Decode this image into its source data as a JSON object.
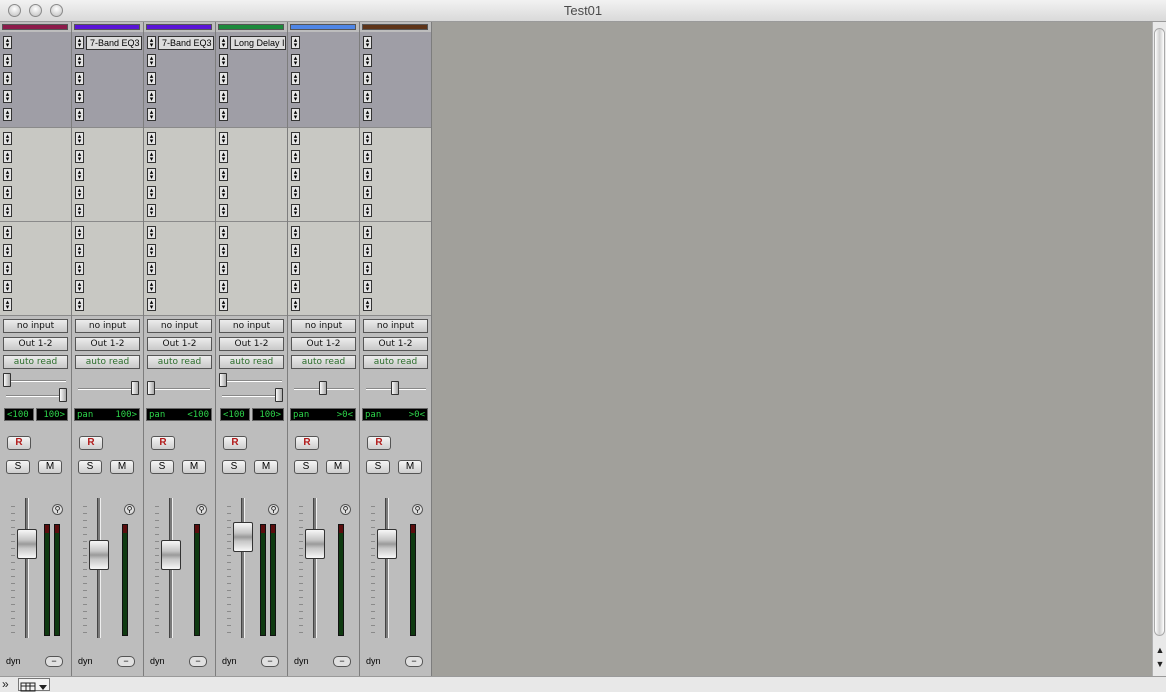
{
  "window": {
    "title": "Test01"
  },
  "tracks": [
    {
      "color": "#8c1b4a",
      "inserts": [
        "",
        "",
        "",
        "",
        ""
      ],
      "input": "no input",
      "output": "Out 1-2",
      "automation": "auto read",
      "stereo": true,
      "pan_left": "<100",
      "pan_right": "100>",
      "pan_label": "",
      "pan_value": "",
      "pan_fraction": 0.0,
      "pan2_fraction": 1.0,
      "record": "R",
      "solo": "S",
      "mute": "M",
      "fader_level": 0.74,
      "dyn": "dyn",
      "dash": "−"
    },
    {
      "color": "#5a14d6",
      "inserts": [
        "7-Band EQ3",
        "",
        "",
        "",
        ""
      ],
      "input": "no input",
      "output": "Out 1-2",
      "automation": "auto read",
      "stereo": false,
      "pan_label": "pan",
      "pan_value": "100>",
      "pan_fraction": 1.0,
      "record": "R",
      "solo": "S",
      "mute": "M",
      "fader_level": 0.64,
      "dyn": "dyn",
      "dash": "−"
    },
    {
      "color": "#5a14d6",
      "inserts": [
        "7-Band EQ3",
        "",
        "",
        "",
        ""
      ],
      "input": "no input",
      "output": "Out 1-2",
      "automation": "auto read",
      "stereo": false,
      "pan_label": "pan",
      "pan_value": "<100",
      "pan_fraction": 0.0,
      "record": "R",
      "solo": "S",
      "mute": "M",
      "fader_level": 0.64,
      "dyn": "dyn",
      "dash": "−"
    },
    {
      "color": "#1d8a3c",
      "inserts": [
        "Long Delay II",
        "",
        "",
        "",
        ""
      ],
      "input": "no input",
      "output": "Out 1-2",
      "automation": "auto read",
      "stereo": true,
      "pan_left": "<100",
      "pan_right": "100>",
      "pan_label": "",
      "pan_value": "",
      "pan_fraction": 0.0,
      "pan2_fraction": 1.0,
      "record": "R",
      "solo": "S",
      "mute": "M",
      "fader_level": 0.8,
      "dyn": "dyn",
      "dash": "−"
    },
    {
      "color": "#4f86e6",
      "inserts": [
        "",
        "",
        "",
        "",
        ""
      ],
      "input": "no input",
      "output": "Out 1-2",
      "automation": "auto read",
      "stereo": false,
      "pan_label": "pan",
      "pan_value": ">0<",
      "pan_fraction": 0.5,
      "record": "R",
      "solo": "S",
      "mute": "M",
      "fader_level": 0.74,
      "dyn": "dyn",
      "dash": "−"
    },
    {
      "color": "#5e3418",
      "inserts": [
        "",
        "",
        "",
        "",
        ""
      ],
      "input": "no input",
      "output": "Out 1-2",
      "automation": "auto read",
      "stereo": false,
      "pan_label": "pan",
      "pan_value": ">0<",
      "pan_fraction": 0.5,
      "record": "R",
      "solo": "S",
      "mute": "M",
      "fader_level": 0.74,
      "dyn": "dyn",
      "dash": "−"
    }
  ],
  "bottom": {
    "expand_icon": "»",
    "view_icon": "table-grid-icon"
  }
}
